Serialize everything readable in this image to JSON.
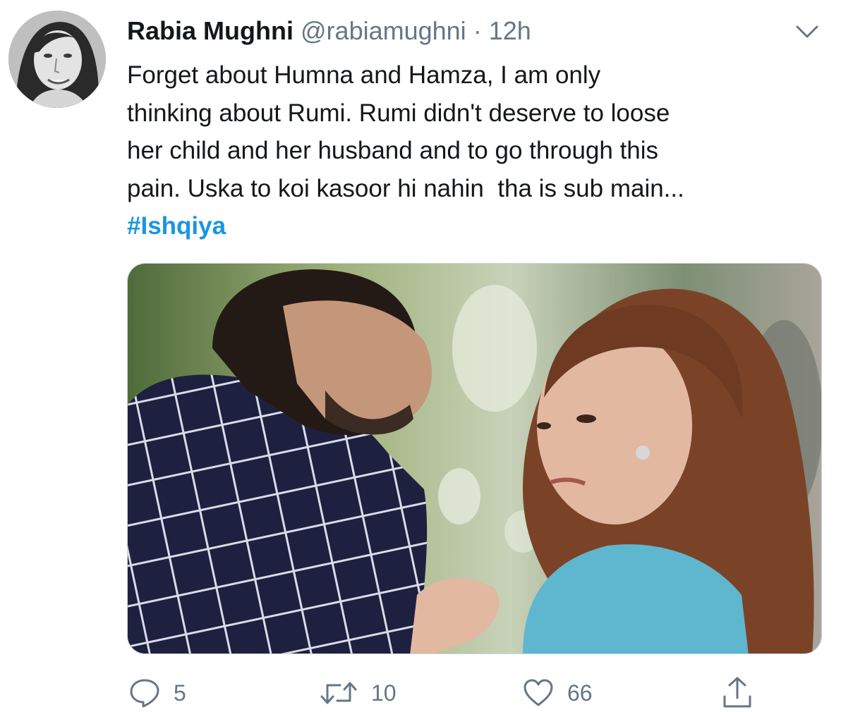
{
  "tweet": {
    "author_name": "Rabia Mughni",
    "author_handle": "@rabiamughni",
    "separator": "·",
    "timestamp": "12h",
    "text_lines": [
      "Forget about Humna and Hamza, I am only",
      "thinking about Rumi. Rumi didn't deserve to loose",
      "her child and her husband and to go through this",
      "pain. Uska to koi kasoor hi nahin  tha is sub main..."
    ],
    "hashtag": "#Ishqiya",
    "media_alt": "",
    "actions": {
      "reply": {
        "icon": "reply-icon",
        "count": "5"
      },
      "retweet": {
        "icon": "retweet-icon",
        "count": "10"
      },
      "like": {
        "icon": "heart-icon",
        "count": "66"
      },
      "share": {
        "icon": "share-icon",
        "count": ""
      }
    }
  },
  "colors": {
    "text": "#14171a",
    "secondary": "#657786",
    "link": "#1b95e0",
    "icon": "#657786"
  }
}
